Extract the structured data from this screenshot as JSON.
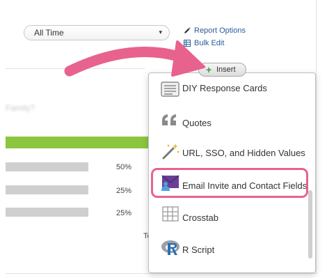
{
  "filter": {
    "selected": "All Time",
    "caret": "▾"
  },
  "options": {
    "report_options": "Report Options",
    "bulk_edit": "Bulk Edit"
  },
  "insert_button": {
    "plus": "+",
    "label": "Insert"
  },
  "question": {
    "title_blurred": "Family?"
  },
  "results": {
    "rows": [
      {
        "percent": "50%"
      },
      {
        "percent": "25%"
      },
      {
        "percent": "25%"
      }
    ],
    "truncated_label": "To"
  },
  "menu": {
    "items": [
      {
        "label": "DIY Response Cards",
        "icon": "response-cards-icon"
      },
      {
        "label": "Quotes",
        "icon": "quote-icon"
      },
      {
        "label": "URL, SSO, and Hidden Values",
        "icon": "magic-wand-icon"
      },
      {
        "label": "Email Invite and Contact Fields",
        "icon": "email-invite-icon"
      },
      {
        "label": "Crosstab",
        "icon": "crosstab-grid-icon"
      },
      {
        "label": "R Script",
        "icon": "r-logo-icon"
      }
    ],
    "highlighted_item": "Email Invite and Contact Fields"
  },
  "colors": {
    "accent_link": "#2a5a9b",
    "highlight": "#e8628e",
    "bar_green": "#8cc63f",
    "bar_gray": "#cfcfcf"
  }
}
